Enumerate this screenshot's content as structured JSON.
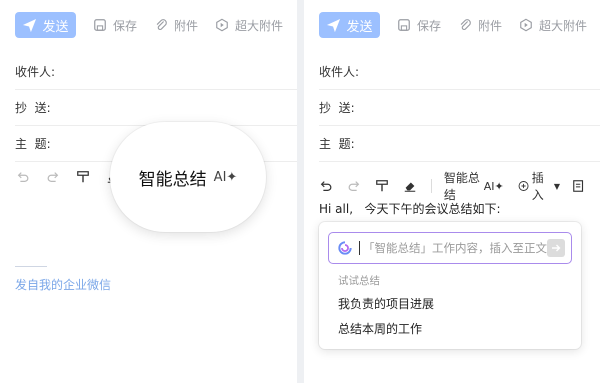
{
  "toolbar": {
    "send": "发送",
    "save": "保存",
    "attach": "附件",
    "large_attach": "超大附件"
  },
  "fields": {
    "to": "收件人:",
    "cc": "抄  送:",
    "subject": "主  题:"
  },
  "format": {
    "smart_summary": "智能总结",
    "ai": "AI",
    "insert": "插入"
  },
  "left": {
    "zoom_label": "智能总结",
    "zoom_ai": "AI",
    "signature": "发自我的企业微信"
  },
  "right": {
    "greeting": "Hi all,   今天下午的会议总结如下:",
    "prompt_placeholder": "「智能总结」工作内容，插入至正文",
    "suggestions_title": "试试总结",
    "suggestions": [
      "我负责的项目进展",
      "总结本周的工作"
    ]
  },
  "colors": {
    "send_bg": "#9cc0ff",
    "prompt_border": "#a98bec",
    "signature": "#7ba7e8"
  }
}
